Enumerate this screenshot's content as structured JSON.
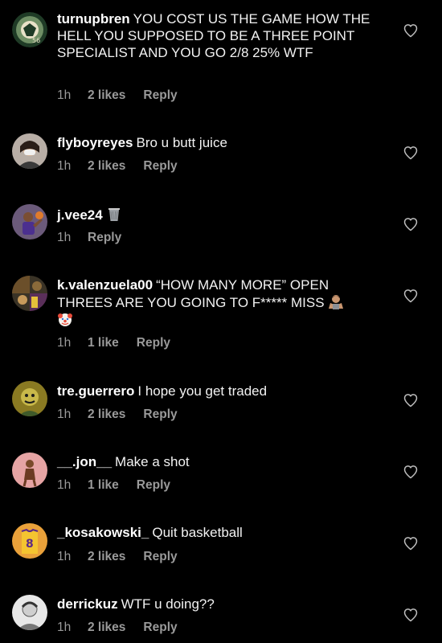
{
  "colors": {
    "background": "#000000",
    "text": "#f2f2f2",
    "meta": "#9a9a9a"
  },
  "comments": [
    {
      "username": "turnupbren",
      "text": "YOU COST US THE GAME HOW THE HELL YOU SUPPOSED TO BE A THREE POINT SPECIALIST AND YOU GO 2/8 25% WTF",
      "time": "1h",
      "likes": "2 likes",
      "reply": "Reply",
      "avatar": "bucks-logo-avatar"
    },
    {
      "username": "flyboyreyes",
      "text": "Bro u butt juice",
      "time": "1h",
      "likes": "2 likes",
      "reply": "Reply",
      "avatar": "person-avatar"
    },
    {
      "username": "j.vee24",
      "text": "",
      "emoji_after": "wastebasket-icon",
      "time": "1h",
      "likes": "",
      "reply": "Reply",
      "avatar": "basketball-player-avatar"
    },
    {
      "username": "k.valenzuela00",
      "text": "“HOW MANY MORE” OPEN THREES ARE YOU GOING TO F***** MISS",
      "emoji_after": "person-shrugging-icon",
      "emoji_line2": "clown-face-icon",
      "time": "1h",
      "likes": "1 like",
      "reply": "Reply",
      "avatar": "collage-avatar"
    },
    {
      "username": "tre.guerrero",
      "text": "I hope you get traded",
      "time": "1h",
      "likes": "2 likes",
      "reply": "Reply",
      "avatar": "cartoon-avatar"
    },
    {
      "username": "__.jon__",
      "text": "Make a shot",
      "time": "1h",
      "likes": "1 like",
      "reply": "Reply",
      "avatar": "figure-avatar"
    },
    {
      "username": "_kosakowski_",
      "text": "Quit basketball",
      "time": "1h",
      "likes": "2 likes",
      "reply": "Reply",
      "avatar": "jersey-avatar"
    },
    {
      "username": "derrickuz",
      "text": "WTF u doing??",
      "time": "1h",
      "likes": "2 likes",
      "reply": "Reply",
      "avatar": "portrait-avatar"
    }
  ]
}
